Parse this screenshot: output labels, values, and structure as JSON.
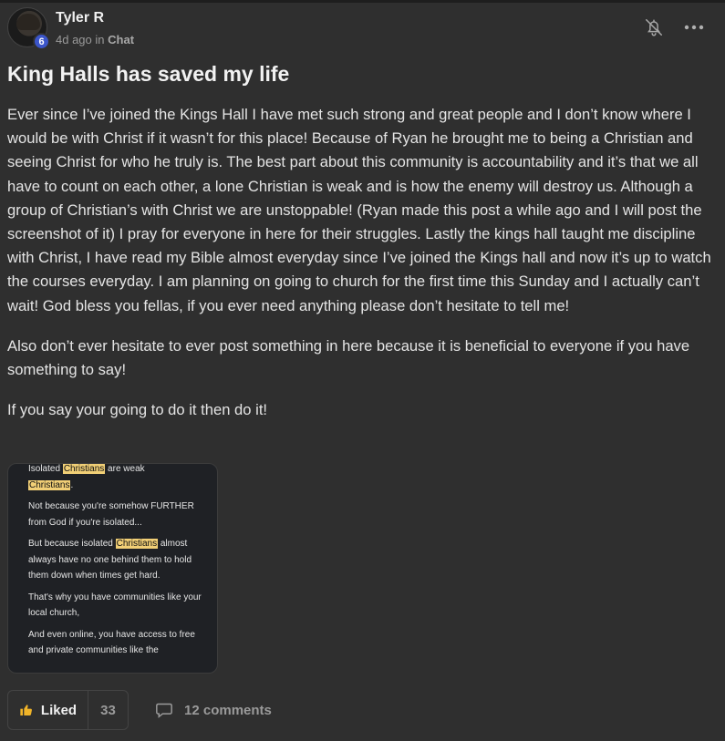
{
  "post": {
    "author": "Tyler R",
    "level": "6",
    "time": "4d ago",
    "in_word": "in",
    "category": "Chat",
    "title": "King Halls has saved my life",
    "paragraphs": [
      "Ever since I’ve joined the Kings Hall I have met such strong and great people and I don’t know where I would be with Christ if it wasn’t for this place! Because of Ryan he brought me to being a Christian and seeing Christ for who he truly is. The best part about this community is accountability and it’s that we all have to count on each other, a lone Christian is weak and is how the enemy will destroy us. Although a group of Christian’s with Christ we are unstoppable! (Ryan made this post a while ago and I will post the screenshot of it) I pray for everyone in here for their struggles. Lastly the kings hall taught me discipline with Christ, I have read my Bible almost everyday since I’ve joined the Kings hall and now it’s up to watch the courses everyday. I am planning on going to church for the first time this Sunday and I actually can’t wait! God bless you fellas, if you ever need anything please don’t hesitate to tell me!",
      "Also don’t ever hesitate to ever post something in here because it is beneficial to everyone if you have something to say!",
      "If you say your going to do it then do it!"
    ]
  },
  "attachment": {
    "l1a": "Isolated ",
    "l1hl": "Christians",
    "l1b": " are weak",
    "l2hl": "Christians",
    "l2b": ".",
    "p2": "Not because you're somehow FURTHER from God if you're isolated...",
    "p3a": "But because isolated ",
    "p3hl": "Christians",
    "p3b": " almost always have no one behind them to hold them down when times get hard.",
    "p4": "That's why you have communities like your local church,",
    "p5": "And even online, you have access to free and private communities like the"
  },
  "actions": {
    "like_label": "Liked",
    "like_count": "33",
    "comments_label": "12 comments"
  },
  "colors": {
    "background": "#2f2f2f",
    "level_badge": "#3b55c9",
    "highlight": "#f1cf76",
    "like_icon": "#f0b429"
  }
}
